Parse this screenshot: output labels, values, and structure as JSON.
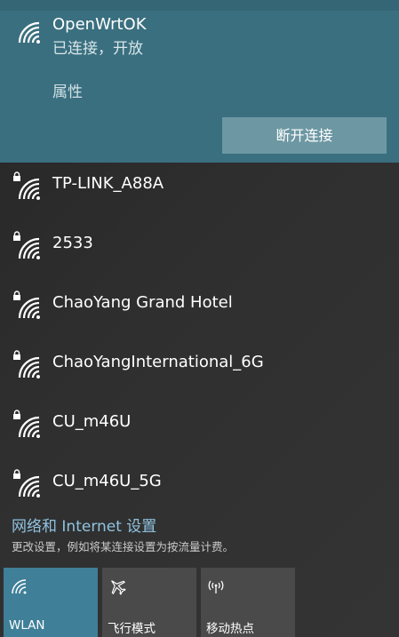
{
  "connected_network": {
    "name": "OpenWrtOK",
    "status": "已连接，开放",
    "properties_label": "属性",
    "disconnect_label": "断开连接"
  },
  "networks": [
    {
      "name": "TP-LINK_A88A",
      "secured": true
    },
    {
      "name": "2533",
      "secured": true
    },
    {
      "name": "ChaoYang Grand Hotel",
      "secured": true
    },
    {
      "name": "ChaoYangInternational_6G",
      "secured": true
    },
    {
      "name": "CU_m46U",
      "secured": true
    },
    {
      "name": "CU_m46U_5G",
      "secured": true
    }
  ],
  "settings": {
    "link_label": "网络和 Internet 设置",
    "hint": "更改设置，例如将某连接设置为按流量计费。"
  },
  "quick_actions": [
    {
      "label": "WLAN",
      "icon": "wifi-icon",
      "active": true
    },
    {
      "label": "飞行模式",
      "icon": "airplane-icon",
      "active": false
    },
    {
      "label": "移动热点",
      "icon": "hotspot-icon",
      "active": false
    }
  ],
  "colors": {
    "connected_bg": "#3a6f7f",
    "disconnect_button": "#6d98a3",
    "link_color": "#8fc3e0",
    "wlan_tile_active": "#3f7f98",
    "tile_inactive": "#4a4a4a"
  }
}
